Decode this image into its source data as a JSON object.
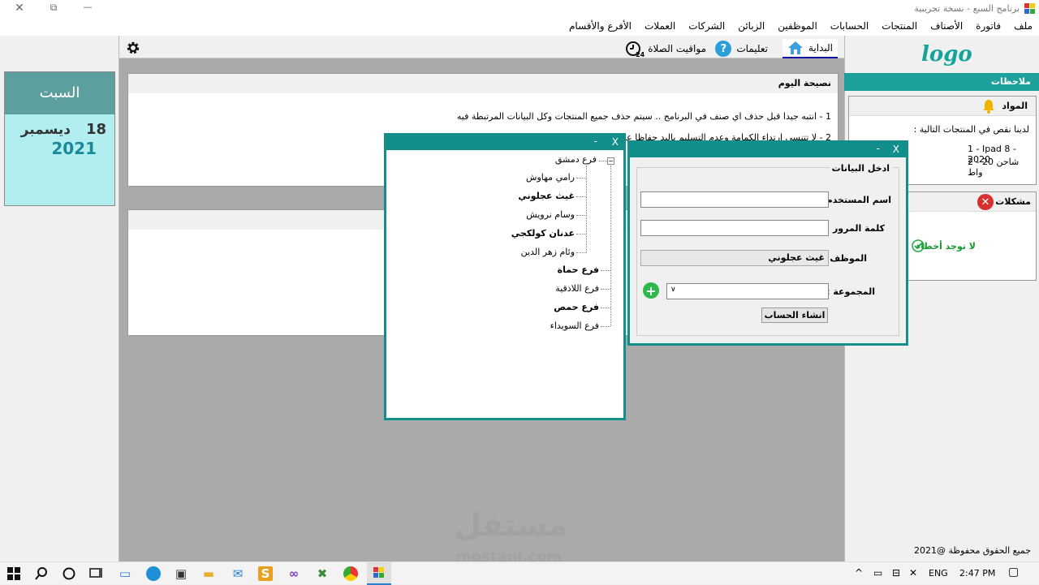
{
  "window": {
    "title": "برنامج السبع - نسخة تجريبية",
    "minimize": "—",
    "maximize": "⧉",
    "close": "✕"
  },
  "menu": [
    "ملف",
    "فاتورة",
    "الأصناف",
    "المنتجات",
    "الحسابات",
    "الموظفين",
    "الزبائن",
    "الشركات",
    "العملات",
    "الأفرع والأقسام"
  ],
  "date_card": {
    "day_name": "السبت",
    "day_number": "18",
    "month": "ديسمبر",
    "year": "2021"
  },
  "tabs": {
    "home": "البداية",
    "help": "تعليمات",
    "prayer": "مواقيت الصلاة",
    "prayer_badge": "24"
  },
  "tip": {
    "title": "نصيحة اليوم",
    "line1": "1 - انتبه جيدا قبل حذف اي صنف في البرنامج .. سيتم حذف جميع المنتجات وكل البيانات المرتبطة فيه",
    "line2": "2 - لا تتنسى ارتداء الكمامة وعدم التسليم باليد حفاظا على سلا"
  },
  "right_panel": {
    "logo": "logo",
    "notes_title": "ملاحظات",
    "materials_title": "المواد",
    "materials_intro": "لدينا نقص في المنتجات التالية :",
    "materials_items": [
      "1 - Ipad 8 - 2020",
      "2 - شاحن 20 واط"
    ],
    "problems_title": "مشكلات",
    "problems_status": "لا توجد أخطاء",
    "copyright": "جميع الحقوق محفوظة @2021"
  },
  "tree": {
    "minimize": "-",
    "close": "X",
    "root": "فرع دمشق",
    "children": [
      "رامي مهاوش",
      "غيث عجلوني",
      "وسام نرويش",
      "عدنان كولكجي",
      "وئام زهر الدين"
    ],
    "branches": [
      "فرع حماة",
      "فرع اللاذقية",
      "فرع حمص",
      "فرع السويداء"
    ]
  },
  "login": {
    "minimize": "-",
    "close": "X",
    "group_title": "ادخل البيانات",
    "username_label": "اسم المستخدم :",
    "username_value": "",
    "password_label": "كلمة المرور :",
    "password_value": "",
    "employee_label": "الموظف :",
    "employee_value": "غيث عجلوني",
    "group_label": "المجموعة :",
    "group_value": "",
    "submit": "انشاء الحساب"
  },
  "taskbar": {
    "lang": "ENG",
    "time": "2:47 PM"
  },
  "watermark": {
    "arabic": "مستقل",
    "latin": "mostaql.com"
  },
  "colors": {
    "teal": "#138f8b",
    "notes_header": "#1ea09d",
    "date_header": "#5d9e9f",
    "date_bg": "#b2eef0"
  }
}
